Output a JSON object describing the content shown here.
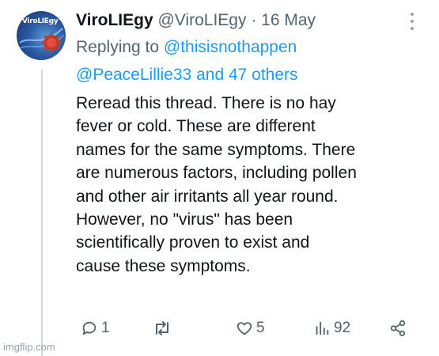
{
  "tweet": {
    "avatar": {
      "label": "ViroLIEgy",
      "icon": "virus-logo-icon"
    },
    "display_name": "ViroLIEgy",
    "handle": "@ViroLIEgy",
    "separator": "·",
    "date": "16 May",
    "replying_prefix": "Replying to",
    "mentions": [
      "@thisisnothappen",
      "@PeaceLillie33"
    ],
    "others": "and 47 others",
    "body_lines": [
      "Reread this thread. There is no hay",
      "fever or cold. These are different",
      "names for the same symptoms. There",
      "are numerous factors, including pollen",
      "and other air irritants all year round.",
      "However, no \"virus\" has been",
      "scientifically proven to exist and",
      "cause these symptoms."
    ],
    "actions": {
      "replies": "1",
      "retweets": "",
      "likes": "5",
      "views": "92"
    }
  },
  "watermark": "imgflip.com",
  "colors": {
    "muted": "#536471",
    "link": "#1d9bf0",
    "text": "#0f1419",
    "thread_line": "#cfd9de"
  }
}
